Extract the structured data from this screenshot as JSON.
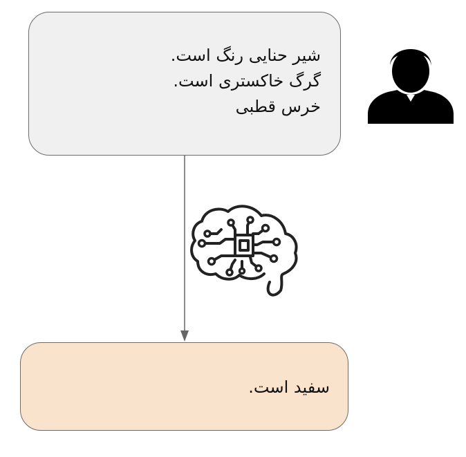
{
  "input": {
    "lines": [
      "شیر حنایی رنگ است.",
      "گرگ خاکستری است.",
      "خرس قطبی"
    ]
  },
  "output": {
    "text": "سفید است."
  },
  "icons": {
    "user": "user-silhouette-icon",
    "model": "brain-circuit-icon"
  },
  "colors": {
    "input_fill": "#f0f0f0",
    "output_fill": "#fae3cd",
    "border": "#6b6b6b",
    "icon": "#000000"
  }
}
